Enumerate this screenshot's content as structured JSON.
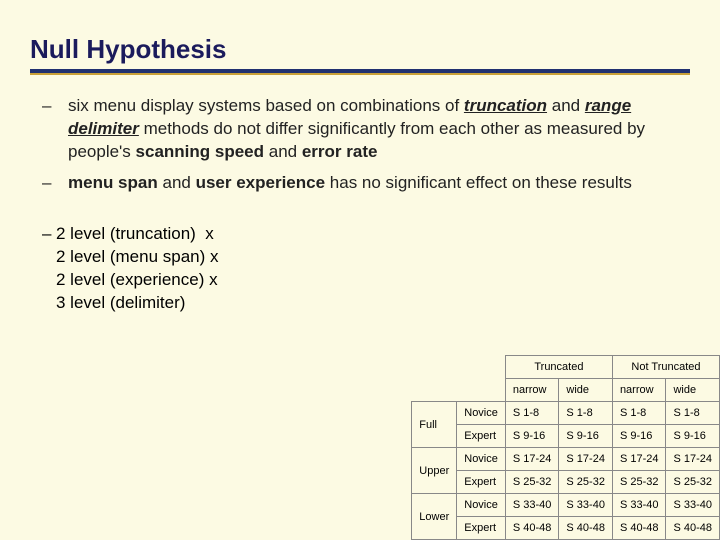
{
  "title": "Null Hypothesis",
  "b1": {
    "a": "six menu display systems based on combinations of ",
    "b": "truncation",
    "c": " and ",
    "d": "range delimiter",
    "e": " methods do not differ significantly from each other as measured by people's ",
    "f": "scanning speed",
    "g": " and ",
    "h": "error rate"
  },
  "b2": {
    "a": "menu span",
    "b": " and ",
    "c": "user experience",
    "d": " has no significant effect on these results"
  },
  "lv": {
    "l1": "2 level (truncation)  x",
    "l2": "2 level (menu span) x",
    "l3": "2 level (experience) x",
    "l4": "3 level (delimiter)"
  },
  "tbl": {
    "g1": "Truncated",
    "g2": "Not Truncated",
    "c1": "narrow",
    "c2": "wide",
    "rg1": "Full",
    "rg2": "Upper",
    "rg3": "Lower",
    "r1": "Novice",
    "r2": "Expert",
    "rows": [
      [
        "S 1-8",
        "S 1-8",
        "S 1-8",
        "S 1-8"
      ],
      [
        "S 9-16",
        "S 9-16",
        "S 9-16",
        "S 9-16"
      ],
      [
        "S 17-24",
        "S 17-24",
        "S 17-24",
        "S 17-24"
      ],
      [
        "S 25-32",
        "S 25-32",
        "S 25-32",
        "S 25-32"
      ],
      [
        "S 33-40",
        "S 33-40",
        "S 33-40",
        "S 33-40"
      ],
      [
        "S 40-48",
        "S 40-48",
        "S 40-48",
        "S 40-48"
      ]
    ]
  }
}
